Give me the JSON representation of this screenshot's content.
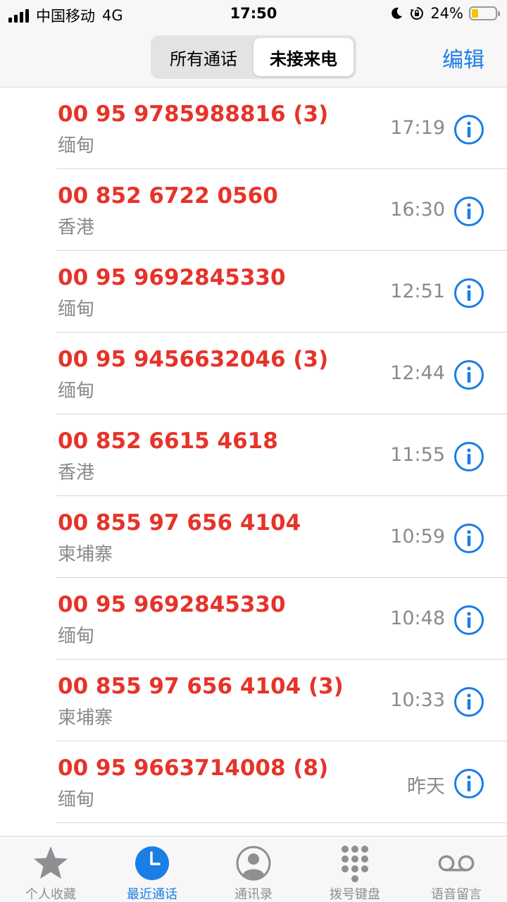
{
  "status_bar": {
    "carrier": "中国移动",
    "network": "4G",
    "time": "17:50",
    "battery": "24%",
    "icons": [
      "signal-icon",
      "moon-icon",
      "orientation-lock-icon",
      "battery-icon"
    ]
  },
  "header": {
    "segments": [
      "所有通话",
      "未接来电"
    ],
    "active_segment": "未接来电",
    "edit_label": "编辑"
  },
  "colors": {
    "missed": "#e6332a",
    "accent": "#1a7ee6",
    "secondary_text": "#8a8a8a"
  },
  "calls": [
    {
      "number": "00 95 9785988816 (3)",
      "region": "缅甸",
      "time": "17:19"
    },
    {
      "number": "00 852 6722 0560",
      "region": "香港",
      "time": "16:30"
    },
    {
      "number": "00 95 9692845330",
      "region": "缅甸",
      "time": "12:51"
    },
    {
      "number": "00 95 9456632046 (3)",
      "region": "缅甸",
      "time": "12:44"
    },
    {
      "number": "00 852 6615 4618",
      "region": "香港",
      "time": "11:55"
    },
    {
      "number": "00 855 97 656 4104",
      "region": "柬埔寨",
      "time": "10:59"
    },
    {
      "number": "00 95 9692845330",
      "region": "缅甸",
      "time": "10:48"
    },
    {
      "number": "00 855 97 656 4104 (3)",
      "region": "柬埔寨",
      "time": "10:33"
    },
    {
      "number": "00 95 9663714008 (8)",
      "region": "缅甸",
      "time": "昨天"
    }
  ],
  "tabbar": {
    "tabs": [
      {
        "label": "个人收藏",
        "icon": "star-icon"
      },
      {
        "label": "最近通话",
        "icon": "clock-icon"
      },
      {
        "label": "通讯录",
        "icon": "contacts-icon"
      },
      {
        "label": "拨号键盘",
        "icon": "keypad-icon"
      },
      {
        "label": "语音留言",
        "icon": "voicemail-icon"
      }
    ],
    "active": "最近通话"
  }
}
